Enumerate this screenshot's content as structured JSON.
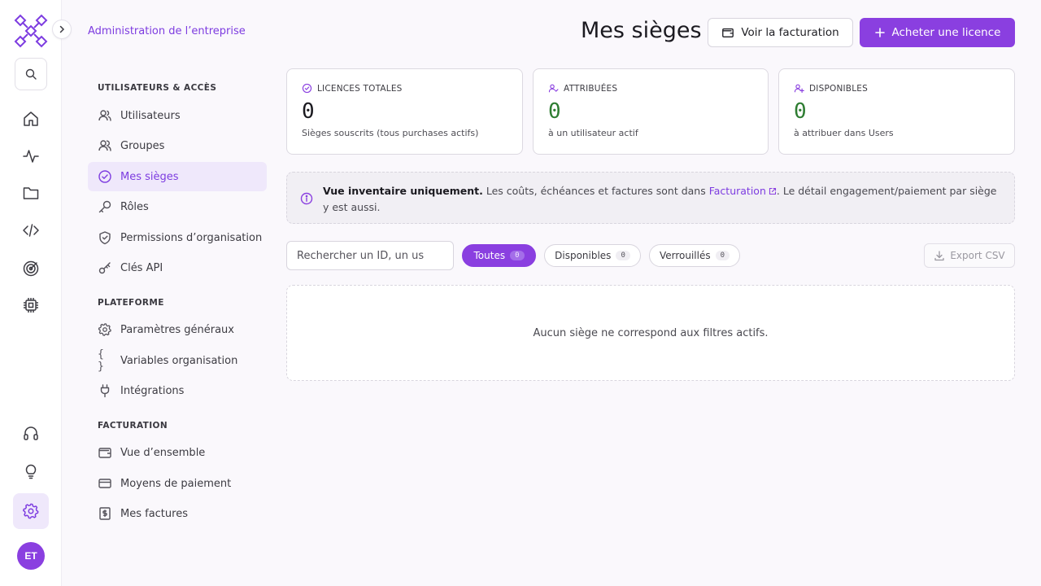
{
  "brand": {
    "accent": "#8a3fe0",
    "accent_soft": "#efe8fb",
    "success": "#2e7d32"
  },
  "rail": {
    "icons": [
      "search-icon",
      "home-icon",
      "activity-icon",
      "folder-icon",
      "code-icon",
      "target-icon",
      "chip-icon",
      "headset-icon",
      "lightbulb-icon",
      "gear-icon"
    ],
    "avatar_initials": "ET"
  },
  "nav": {
    "title": "Administration de l’entreprise",
    "sections": [
      {
        "title": "UTILISATEURS & ACCÈS",
        "items": [
          {
            "label": "Utilisateurs",
            "icon": "user-icon"
          },
          {
            "label": "Groupes",
            "icon": "users-icon"
          },
          {
            "label": "Mes sièges",
            "icon": "check-circle-icon",
            "active": true
          },
          {
            "label": "Rôles",
            "icon": "key-icon"
          },
          {
            "label": "Permissions d’organisation",
            "icon": "shield-check-icon"
          },
          {
            "label": "Clés API",
            "icon": "api-key-icon"
          }
        ]
      },
      {
        "title": "PLATEFORME",
        "items": [
          {
            "label": "Paramètres généraux",
            "icon": "gear-icon"
          },
          {
            "label": "Variables organisation",
            "icon": "braces-icon"
          },
          {
            "label": "Intégrations",
            "icon": "plug-icon"
          }
        ]
      },
      {
        "title": "FACTURATION",
        "items": [
          {
            "label": "Vue d’ensemble",
            "icon": "wallet-icon"
          },
          {
            "label": "Moyens de paiement",
            "icon": "credit-card-icon"
          },
          {
            "label": "Mes factures",
            "icon": "invoice-icon"
          }
        ]
      }
    ]
  },
  "header": {
    "title": "Mes sièges",
    "billing_button": "Voir la facturation",
    "buy_button": "Acheter une licence"
  },
  "stats": [
    {
      "label": "LICENCES TOTALES",
      "value": "0",
      "sub": "Sièges souscrits (tous purchases actifs)",
      "icon": "check-circle-icon"
    },
    {
      "label": "ATTRIBUÉES",
      "value": "0",
      "sub": "à un utilisateur actif",
      "icon": "user-check-icon"
    },
    {
      "label": "DISPONIBLES",
      "value": "0",
      "sub": "à attribuer dans Users",
      "icon": "user-plus-icon"
    }
  ],
  "banner": {
    "bold": "Vue inventaire uniquement.",
    "text_before_link": " Les coûts, échéances et factures sont dans ",
    "link": "Facturation",
    "text_after_link": ". Le détail engagement/paiement par siège y est aussi."
  },
  "filters": {
    "search_placeholder": "Rechercher un ID, un us",
    "pills": [
      {
        "label": "Toutes",
        "count": "0",
        "active": true
      },
      {
        "label": "Disponibles",
        "count": "0"
      },
      {
        "label": "Verrouillés",
        "count": "0"
      }
    ],
    "export_label": "Export CSV"
  },
  "empty_state": "Aucun siège ne correspond aux filtres actifs."
}
